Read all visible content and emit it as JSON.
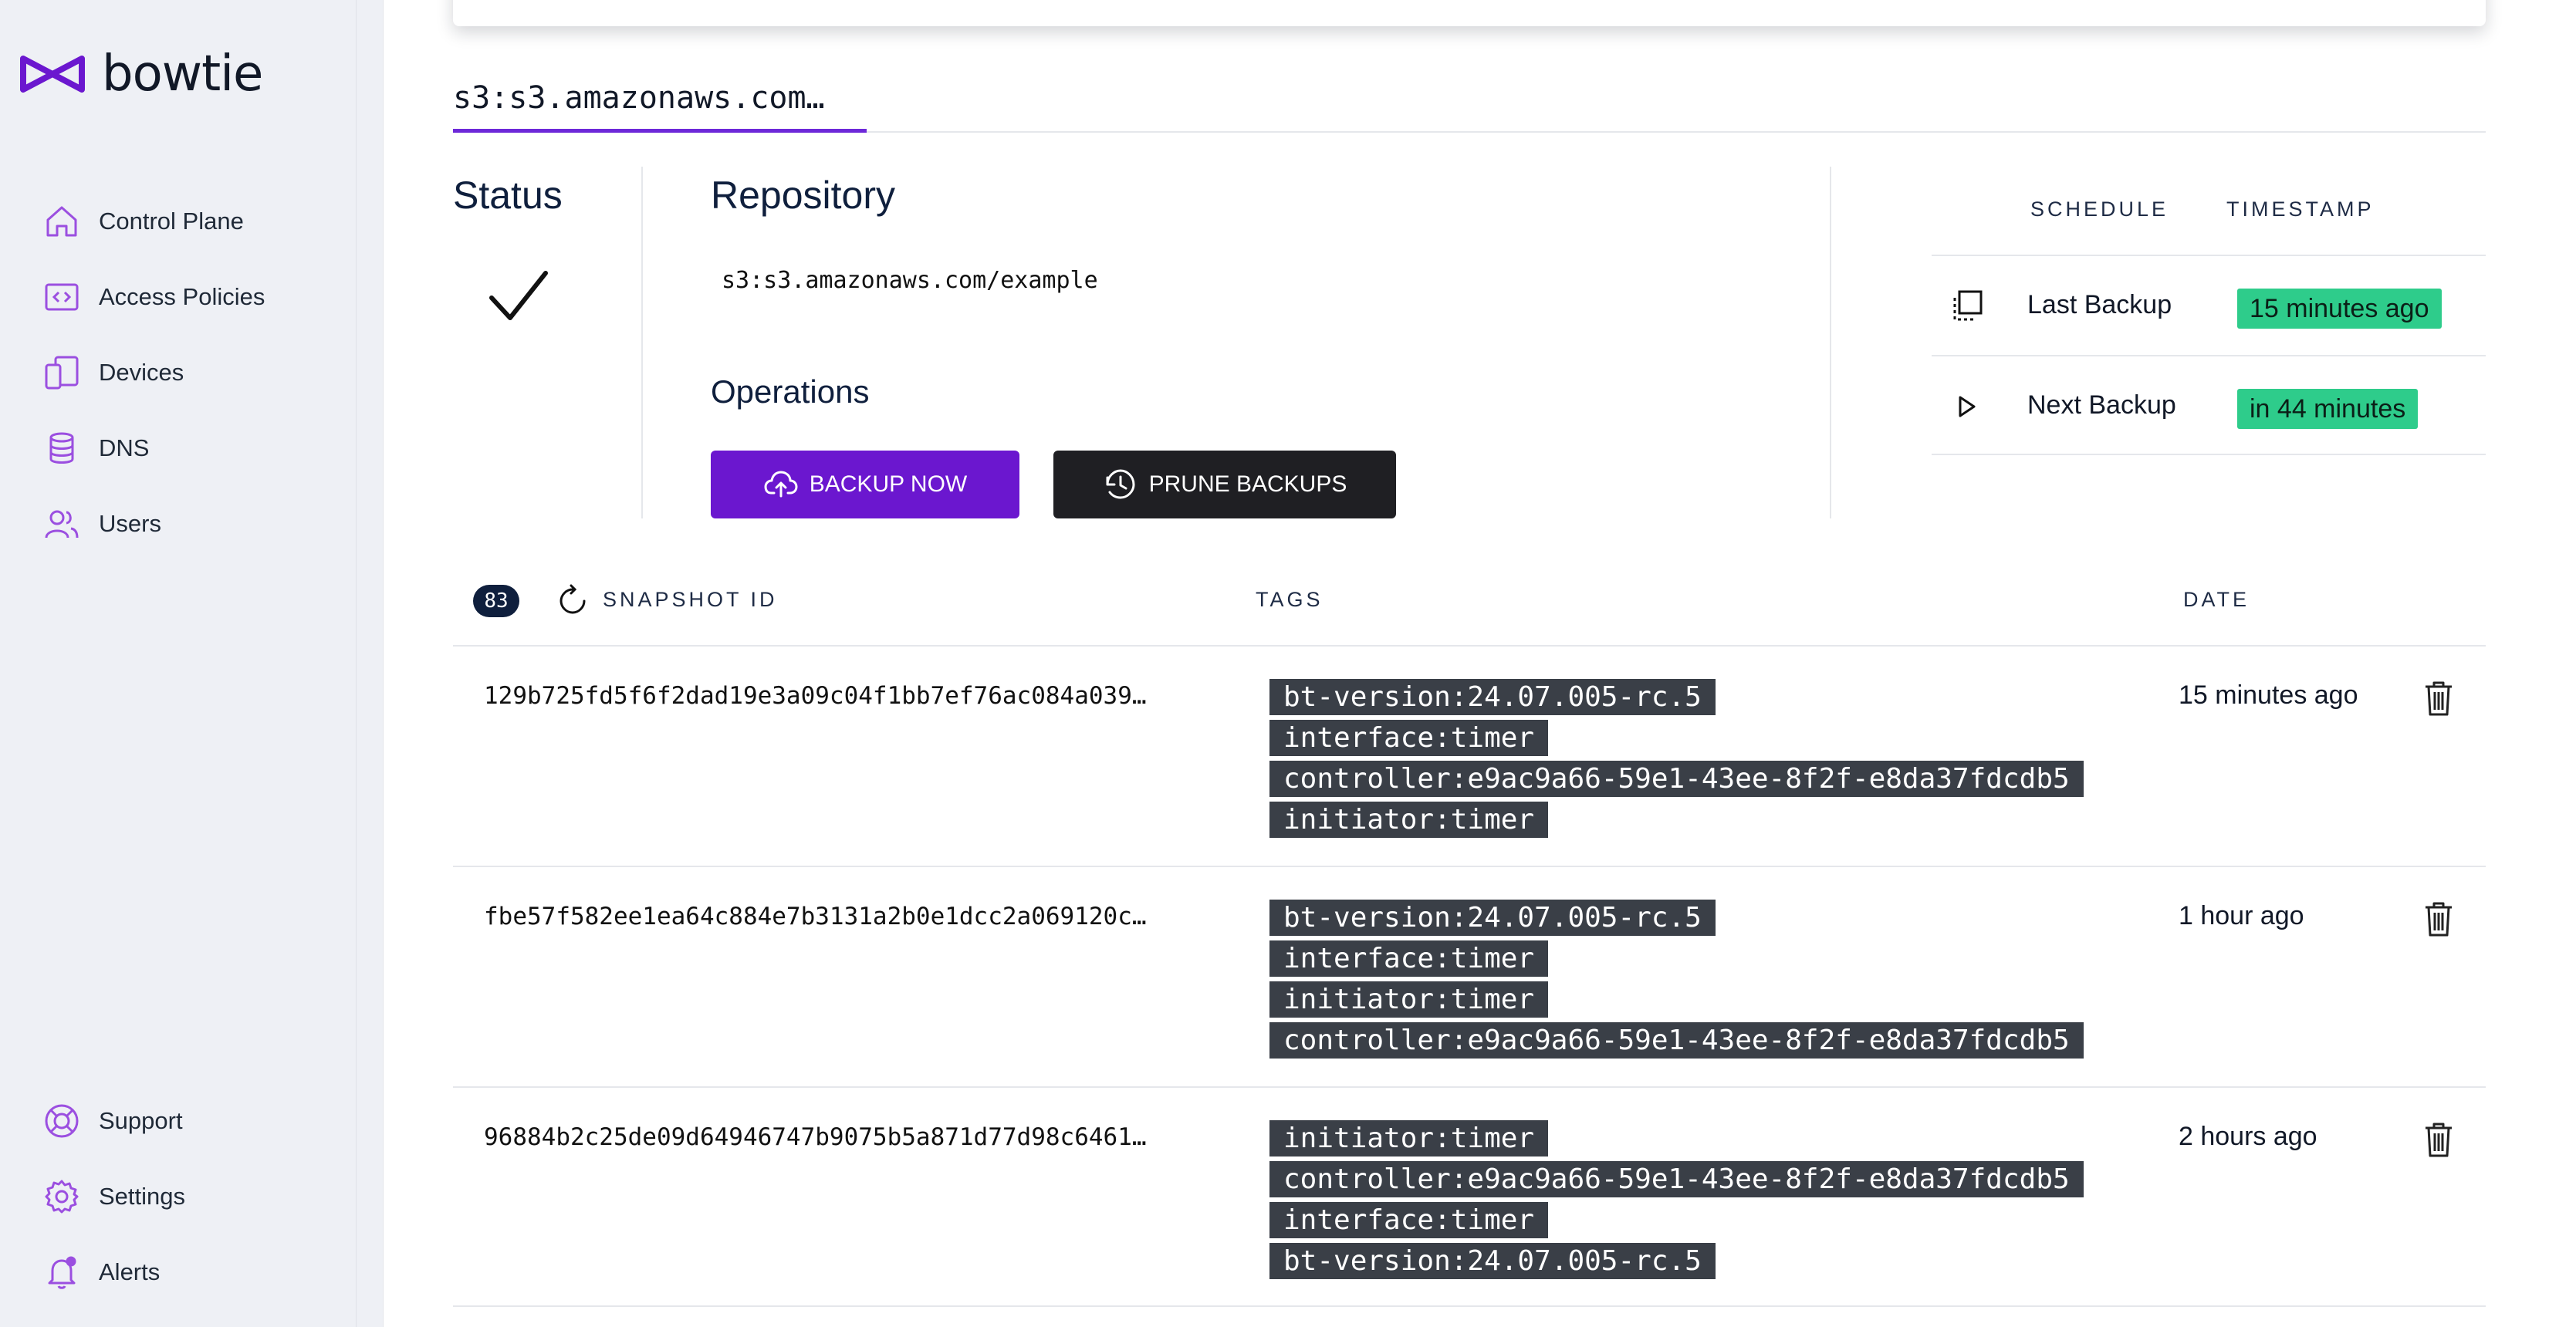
{
  "brand": {
    "name": "bowtie",
    "accent": "#6b17cf"
  },
  "sidebar": {
    "items": [
      {
        "label": "Control Plane",
        "icon": "home-icon"
      },
      {
        "label": "Access Policies",
        "icon": "code-window-icon"
      },
      {
        "label": "Devices",
        "icon": "devices-icon"
      },
      {
        "label": "DNS",
        "icon": "database-icon"
      },
      {
        "label": "Users",
        "icon": "users-icon"
      }
    ],
    "bottom_items": [
      {
        "label": "Support",
        "icon": "lifebuoy-icon"
      },
      {
        "label": "Settings",
        "icon": "gear-icon"
      },
      {
        "label": "Alerts",
        "icon": "bell-icon"
      }
    ]
  },
  "tab": {
    "label": "s3:s3.amazonaws.com…"
  },
  "status": {
    "title": "Status",
    "icon": "checkmark-icon"
  },
  "repository": {
    "title": "Repository",
    "value": "s3:s3.amazonaws.com/example"
  },
  "operations": {
    "title": "Operations",
    "backup_label": "BACKUP NOW",
    "prune_label": "PRUNE BACKUPS",
    "backup_color": "#6b17cf",
    "prune_color": "#1f1f23"
  },
  "schedule": {
    "headers": {
      "schedule": "SCHEDULE",
      "timestamp": "TIMESTAMP"
    },
    "rows": [
      {
        "label": "Last Backup",
        "value": "15 minutes ago",
        "icon": "copy-icon"
      },
      {
        "label": "Next Backup",
        "value": "in 44 minutes",
        "icon": "play-icon"
      }
    ],
    "badge_color": "#2ecc8b"
  },
  "snapshots": {
    "count": "83",
    "headers": {
      "id": "SNAPSHOT ID",
      "tags": "TAGS",
      "date": "DATE"
    },
    "rows": [
      {
        "id": "129b725fd5f6f2dad19e3a09c04f1bb7ef76ac084a039…",
        "tags": [
          "bt-version:24.07.005-rc.5",
          "interface:timer",
          "controller:e9ac9a66-59e1-43ee-8f2f-e8da37fdcdb5",
          "initiator:timer"
        ],
        "date": "15 minutes ago"
      },
      {
        "id": "fbe57f582ee1ea64c884e7b3131a2b0e1dcc2a069120c…",
        "tags": [
          "bt-version:24.07.005-rc.5",
          "interface:timer",
          "initiator:timer",
          "controller:e9ac9a66-59e1-43ee-8f2f-e8da37fdcdb5"
        ],
        "date": "1 hour ago"
      },
      {
        "id": "96884b2c25de09d64946747b9075b5a871d77d98c6461…",
        "tags": [
          "initiator:timer",
          "controller:e9ac9a66-59e1-43ee-8f2f-e8da37fdcdb5",
          "interface:timer",
          "bt-version:24.07.005-rc.5"
        ],
        "date": "2 hours ago"
      }
    ]
  }
}
